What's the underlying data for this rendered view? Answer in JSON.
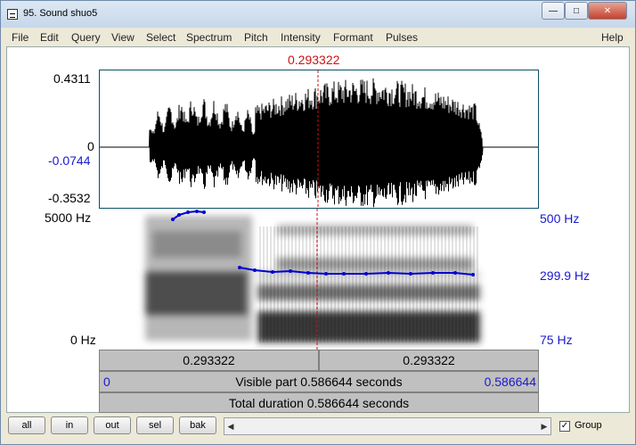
{
  "window": {
    "title": "95. Sound shuo5"
  },
  "titlebar_buttons": {
    "minimize": "—",
    "maximize": "□",
    "close": "✕"
  },
  "menu": [
    "File",
    "Edit",
    "Query",
    "View",
    "Select",
    "Spectrum",
    "Pitch",
    "Intensity",
    "Formant",
    "Pulses"
  ],
  "help": "Help",
  "cursor_time": "0.293322",
  "waveform": {
    "y_top": "0.4311",
    "y_zero": "0",
    "y_cursor": "-0.0744",
    "y_bottom": "-0.3532"
  },
  "spectrogram": {
    "freq_top": "5000 Hz",
    "freq_bottom": "0 Hz"
  },
  "pitch": {
    "top": "500 Hz",
    "value": "299.9 Hz",
    "bottom": "75 Hz"
  },
  "timebar": {
    "left_segment": "0.293322",
    "right_segment": "0.293322",
    "visible_start": "0",
    "visible_label": "Visible part 0.586644 seconds",
    "visible_end": "0.586644",
    "total_label": "Total duration 0.586644 seconds"
  },
  "buttons": {
    "all": "all",
    "in": "in",
    "out": "out",
    "sel": "sel",
    "bak": "bak"
  },
  "group": {
    "label": "Group",
    "checked": "✓"
  },
  "colors": {
    "cursor": "#d01010",
    "pitch": "#0000d0",
    "axis_blue": "#1a1acc"
  }
}
